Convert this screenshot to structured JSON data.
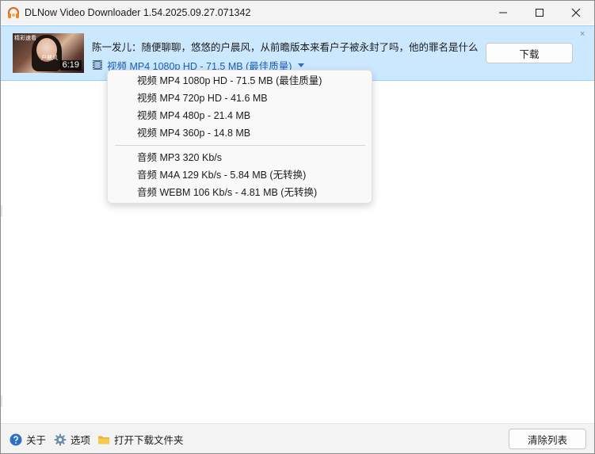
{
  "window": {
    "title": "DLNow Video Downloader 1.54.2025.09.27.071342"
  },
  "item": {
    "title": "陈一发儿：随便聊聊，悠悠的户晨风，从前瞻版本来看户子被永封了吗，他的罪名是什么",
    "duration": "6:19",
    "thumbnail_text": "精彩速看",
    "thumbnail_subtext": "户晨风",
    "selected_format": "视频 MP4 1080p HD - 71.5 MB (最佳质量)",
    "download_label": "下载",
    "close_glyph": "×"
  },
  "menu": {
    "video_options": [
      "视频 MP4 1080p HD - 71.5 MB (最佳质量)",
      "视频 MP4 720p HD - 41.6 MB",
      "视频 MP4 480p - 21.4 MB",
      "视频 MP4 360p - 14.8 MB"
    ],
    "audio_options": [
      "音频 MP3 320 Kb/s",
      "音频 M4A 129 Kb/s - 5.84 MB (无转换)",
      "音频 WEBM 106 Kb/s - 4.81 MB (无转换)"
    ]
  },
  "footer": {
    "about_label": "关于",
    "options_label": "选项",
    "open_folder_label": "打开下载文件夹",
    "clear_label": "清除列表"
  },
  "colors": {
    "accent": "#1a5fb4",
    "selection_bg": "#cce8ff",
    "selection_border": "#99d1ff"
  },
  "icons": {
    "app": "headphones-icon",
    "minimize": "minimize-icon",
    "maximize": "maximize-icon",
    "close": "close-icon",
    "film": "film-icon",
    "dropdown": "chevron-down-icon",
    "about": "help-icon",
    "options": "gear-icon",
    "folder": "folder-icon"
  }
}
